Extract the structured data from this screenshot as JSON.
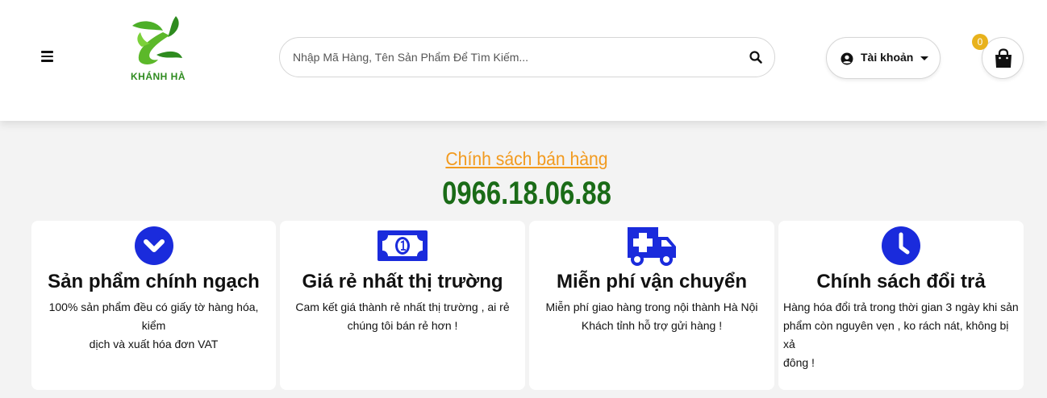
{
  "header": {
    "logo_text": "KHÁNH HÀ",
    "search": {
      "placeholder": "Nhập Mã Hàng, Tên Sản Phẩm Để Tìm Kiếm..."
    },
    "account_label": "Tài khoản",
    "cart_count": "0"
  },
  "policy": {
    "title": "Chính sách bán hàng",
    "phone": "0966.18.06.88"
  },
  "cards": [
    {
      "icon": "chevron-down-circle-icon",
      "title": "Sản phẩm chính ngạch",
      "line1": "100% sản phẩm đều có giấy tờ hàng hóa, kiểm",
      "line2": "dịch và xuất hóa đơn VAT",
      "line3": ""
    },
    {
      "icon": "money-bill-icon",
      "title": "Giá rẻ nhất thị trường",
      "line1": "Cam kết giá thành rẻ nhất thị trường , ai rẻ",
      "line2": "chúng tôi bán rẻ hơn !",
      "line3": ""
    },
    {
      "icon": "ambulance-icon",
      "title": "Miễn phí vận chuyển",
      "line1": "Miễn phí giao hàng trong nội thành Hà Nội",
      "line2": "Khách tỉnh hỗ trợ gửi hàng !",
      "line3": ""
    },
    {
      "icon": "clock-icon",
      "title": "Chính sách đổi trả",
      "line1": "Hàng hóa đổi trả trong thời gian 3 ngày khi sản",
      "line2": "phẩm còn nguyên vẹn , ko rách nát, không bị xả",
      "line3": "đông !"
    }
  ],
  "colors": {
    "accent_blue": "#1a2bdc",
    "title_orange": "#f29a1e",
    "phone_green": "#1a6b17",
    "badge_yellow": "#e8b21c"
  }
}
